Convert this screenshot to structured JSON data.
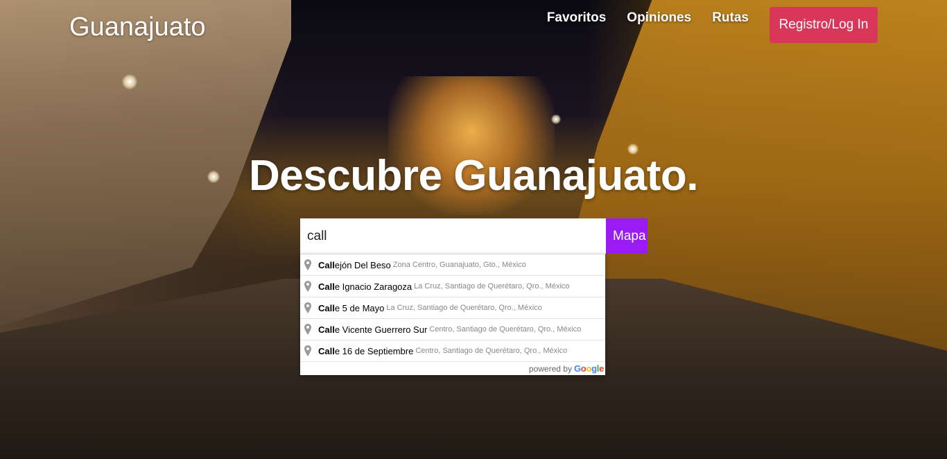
{
  "brand": {
    "name": "Guanajuato"
  },
  "nav": {
    "items": [
      {
        "label": "Favoritos"
      },
      {
        "label": "Opiniones"
      },
      {
        "label": "Rutas"
      }
    ],
    "login_label": "Registro/Log In"
  },
  "hero": {
    "headline": "Descubre Guanajuato."
  },
  "search": {
    "value": "call",
    "map_button_label": "Mapa"
  },
  "suggestions": {
    "items": [
      {
        "match": "Call",
        "rest": "ejón Del Beso",
        "secondary": "Zona Centro, Guanajuato, Gto., México"
      },
      {
        "match": "Call",
        "rest": "e Ignacio Zaragoza",
        "secondary": "La Cruz, Santiago de Querétaro, Qro., México"
      },
      {
        "match": "Call",
        "rest": "e 5 de Mayo",
        "secondary": "La Cruz, Santiago de Querétaro, Qro., México"
      },
      {
        "match": "Call",
        "rest": "e Vicente Guerrero Sur",
        "secondary": "Centro, Santiago de Querétaro, Qro., México"
      },
      {
        "match": "Call",
        "rest": "e 16 de Septiembre",
        "secondary": "Centro, Santiago de Querétaro, Qro., México"
      }
    ],
    "powered_by": "powered by",
    "google_letters": [
      "G",
      "o",
      "o",
      "g",
      "l",
      "e"
    ]
  },
  "colors": {
    "login_button": "#d9375a",
    "map_button": "#9b1bf5"
  },
  "icons": {
    "suggestion": "map-pin-icon"
  }
}
